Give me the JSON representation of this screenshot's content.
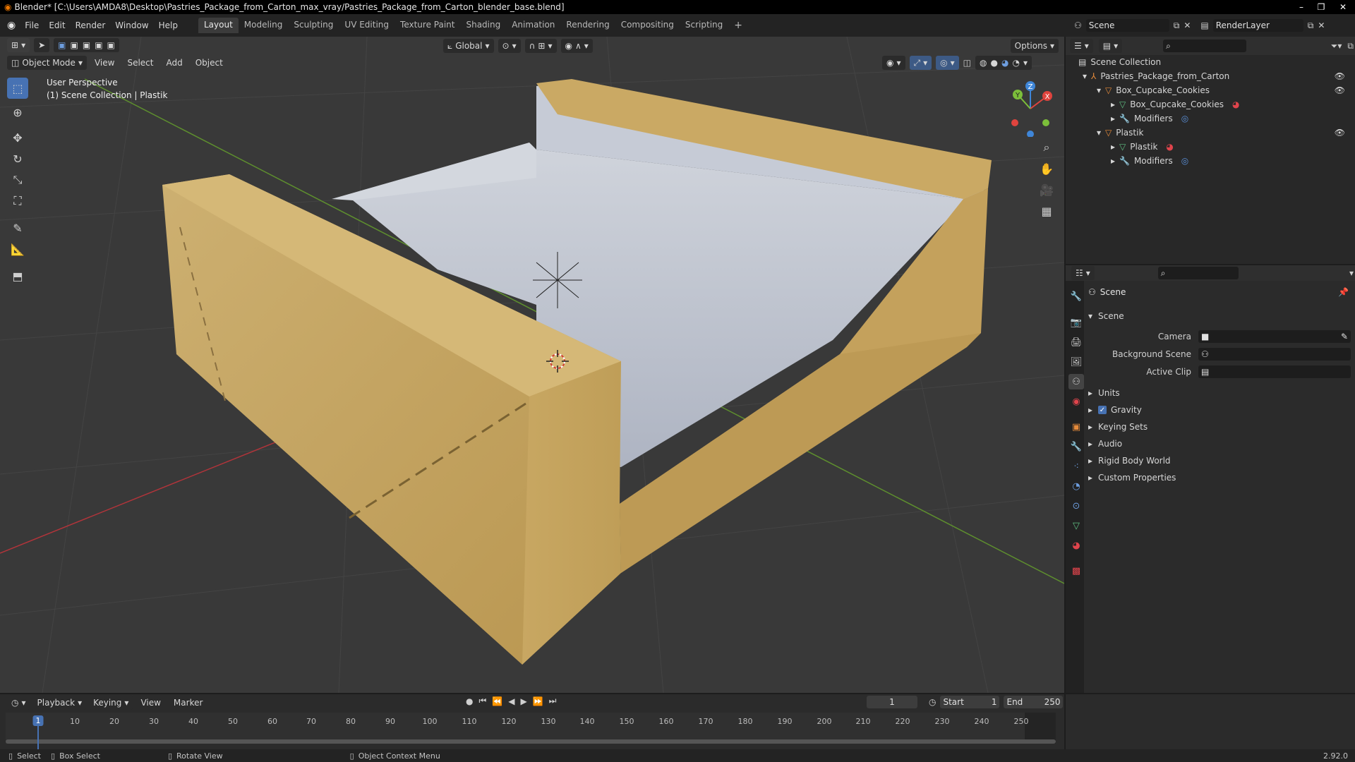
{
  "window": {
    "title": "Blender* [C:\\Users\\AMDA8\\Desktop\\Pastries_Package_from_Carton_max_vray/Pastries_Package_from_Carton_blender_base.blend]",
    "controls": [
      "–",
      "❐",
      "✕"
    ]
  },
  "menu": [
    "File",
    "Edit",
    "Render",
    "Window",
    "Help"
  ],
  "workspaces": [
    "Layout",
    "Modeling",
    "Sculpting",
    "UV Editing",
    "Texture Paint",
    "Shading",
    "Animation",
    "Rendering",
    "Compositing",
    "Scripting"
  ],
  "active_workspace": "Layout",
  "scene_selector": "Scene",
  "view_layer_selector": "RenderLayer",
  "header2": {
    "orientation": "Global",
    "options": "Options",
    "mode": "Object Mode",
    "view_menu": [
      "View",
      "Select",
      "Add",
      "Object"
    ]
  },
  "viewport": {
    "perspective": "User Perspective",
    "collection_info": "(1) Scene Collection | Plastik",
    "gizmo": {
      "x": "X",
      "y": "Y",
      "z": "Z"
    }
  },
  "outliner": {
    "root": "Scene Collection",
    "items": [
      {
        "label": "Pastries_Package_from_Carton",
        "level": 0
      },
      {
        "label": "Box_Cupcake_Cookies",
        "level": 1
      },
      {
        "label": "Box_Cupcake_Cookies",
        "level": 2
      },
      {
        "label": "Modifiers",
        "level": 2
      },
      {
        "label": "Plastik",
        "level": 1
      },
      {
        "label": "Plastik",
        "level": 2
      },
      {
        "label": "Modifiers",
        "level": 2
      }
    ]
  },
  "properties": {
    "context": "Scene",
    "panel": "Scene",
    "fields": [
      {
        "label": "Camera",
        "value": ""
      },
      {
        "label": "Background Scene",
        "value": ""
      },
      {
        "label": "Active Clip",
        "value": ""
      }
    ],
    "sections": [
      {
        "label": "Units",
        "checkbox": false
      },
      {
        "label": "Gravity",
        "checkbox": true
      },
      {
        "label": "Keying Sets",
        "checkbox": false
      },
      {
        "label": "Audio",
        "checkbox": false
      },
      {
        "label": "Rigid Body World",
        "checkbox": false
      },
      {
        "label": "Custom Properties",
        "checkbox": false
      }
    ]
  },
  "timeline": {
    "menus": [
      "Playback",
      "Keying",
      "View",
      "Marker"
    ],
    "current_frame": "1",
    "start_label": "Start",
    "start": "1",
    "end_label": "End",
    "end": "250",
    "ticks": [
      "1",
      "10",
      "20",
      "30",
      "40",
      "50",
      "60",
      "70",
      "80",
      "90",
      "100",
      "110",
      "120",
      "130",
      "140",
      "150",
      "160",
      "170",
      "180",
      "190",
      "200",
      "210",
      "220",
      "230",
      "240",
      "250"
    ]
  },
  "status": {
    "items": [
      "Select",
      "Box Select",
      "Rotate View",
      "Object Context Menu"
    ],
    "version": "2.92.0"
  },
  "colors": {
    "accent": "#4772b3",
    "carton": "#c2a05c",
    "x_axis": "#e0443e",
    "y_axis": "#7cbf3a",
    "z_axis": "#3f86d8"
  }
}
